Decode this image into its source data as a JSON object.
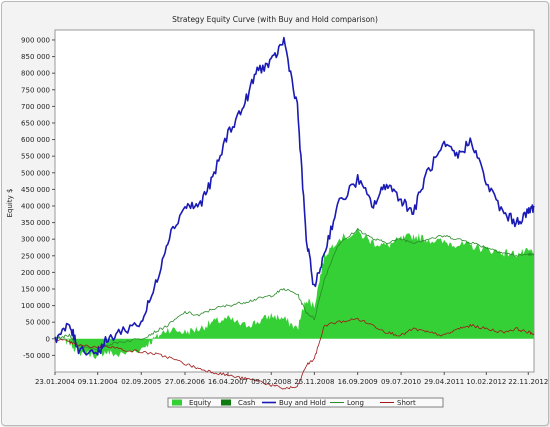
{
  "chart_data": {
    "type": "line",
    "title": "Strategy Equity Curve (with Buy and Hold comparison)",
    "ylabel": "Equity $",
    "xlabel": "",
    "ylim": [
      -100000,
      930000
    ],
    "yticks": [
      -50000,
      0,
      50000,
      100000,
      150000,
      200000,
      250000,
      300000,
      350000,
      400000,
      450000,
      500000,
      550000,
      600000,
      650000,
      700000,
      750000,
      800000,
      850000,
      900000
    ],
    "ytick_labels": [
      "-50 000",
      "0",
      "50 000",
      "100 000",
      "150 000",
      "200 000",
      "250 000",
      "300 000",
      "350 000",
      "400 000",
      "450 000",
      "500 000",
      "550 000",
      "600 000",
      "650 000",
      "700 000",
      "750 000",
      "800 000",
      "850 000",
      "900 000"
    ],
    "xticks": [
      "23.01.2004",
      "09.11.2004",
      "02.09.2005",
      "27.06.2006",
      "16.04.2007",
      "05.02.2008",
      "25.11.2008",
      "16.09.2009",
      "09.07.2010",
      "29.04.2011",
      "10.02.2012",
      "22.11.2012"
    ],
    "grid": false,
    "legend_position": "bottom",
    "x": [
      "2004-01-23",
      "2004-05-01",
      "2004-07-01",
      "2004-11-09",
      "2005-01-01",
      "2005-04-01",
      "2005-09-02",
      "2005-12-01",
      "2006-03-01",
      "2006-06-27",
      "2006-10-01",
      "2007-01-01",
      "2007-04-16",
      "2007-08-01",
      "2007-11-01",
      "2008-02-05",
      "2008-05-01",
      "2008-08-01",
      "2008-10-01",
      "2008-11-25",
      "2009-02-01",
      "2009-05-01",
      "2009-09-16",
      "2010-01-01",
      "2010-04-01",
      "2010-07-09",
      "2010-10-01",
      "2011-01-01",
      "2011-04-29",
      "2011-08-01",
      "2011-11-01",
      "2012-02-10",
      "2012-06-01",
      "2012-09-01",
      "2012-11-22",
      "2012-12-31"
    ],
    "series": [
      {
        "name": "Buy and Hold",
        "color": "#1a1ab4",
        "values": [
          0,
          40000,
          -30000,
          -40000,
          -10000,
          20000,
          50000,
          150000,
          300000,
          400000,
          400000,
          480000,
          620000,
          700000,
          810000,
          830000,
          900000,
          700000,
          300000,
          150000,
          260000,
          400000,
          480000,
          400000,
          470000,
          420000,
          380000,
          500000,
          580000,
          550000,
          600000,
          470000,
          380000,
          350000,
          380000,
          400000
        ]
      },
      {
        "name": "Long",
        "color": "#2b8a2b",
        "values": [
          0,
          10000,
          -20000,
          -30000,
          -20000,
          -10000,
          0,
          20000,
          40000,
          80000,
          70000,
          90000,
          100000,
          110000,
          120000,
          130000,
          150000,
          135000,
          80000,
          60000,
          180000,
          280000,
          330000,
          300000,
          290000,
          300000,
          290000,
          300000,
          310000,
          300000,
          290000,
          275000,
          260000,
          250000,
          255000,
          252000
        ]
      },
      {
        "name": "Short",
        "color": "#a01818",
        "values": [
          0,
          -10000,
          -20000,
          -25000,
          -20000,
          -30000,
          -40000,
          -45000,
          -55000,
          -75000,
          -90000,
          -100000,
          -110000,
          -120000,
          -125000,
          -140000,
          -150000,
          -145000,
          -80000,
          -60000,
          40000,
          50000,
          60000,
          40000,
          20000,
          10000,
          30000,
          20000,
          10000,
          30000,
          40000,
          30000,
          20000,
          30000,
          20000,
          15000
        ]
      },
      {
        "name": "Equity",
        "color": "#35d035",
        "values": [
          0,
          -10000,
          -40000,
          -50000,
          -40000,
          -50000,
          -30000,
          0,
          30000,
          20000,
          30000,
          50000,
          60000,
          40000,
          50000,
          70000,
          60000,
          30000,
          120000,
          100000,
          250000,
          300000,
          320000,
          290000,
          280000,
          300000,
          310000,
          300000,
          290000,
          285000,
          280000,
          270000,
          260000,
          255000,
          262000,
          265000
        ]
      },
      {
        "name": "Cash",
        "color": "#0f7a0f",
        "values": []
      }
    ]
  }
}
